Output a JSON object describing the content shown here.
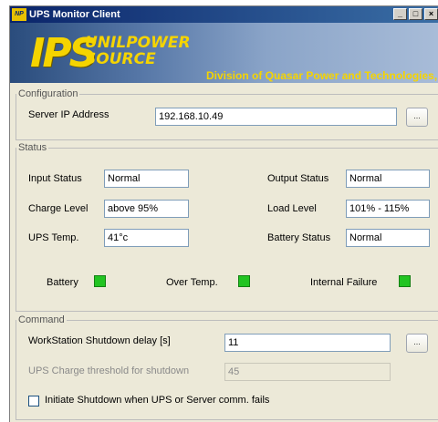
{
  "window": {
    "title": "UPS Monitor Client",
    "app_icon_text": "NP",
    "minimize_glyph": "_",
    "maximize_glyph": "□",
    "close_glyph": "×"
  },
  "banner": {
    "logo_big": "IPS",
    "logo_line1": "UNILPOWER",
    "logo_line2": "SOURCE",
    "division": "Division of Quasar Power and Technologies, Inc."
  },
  "configuration": {
    "legend": "Configuration",
    "server_ip_label": "Server IP Address",
    "server_ip_value": "192.168.10.49",
    "browse_label": "..."
  },
  "status": {
    "legend": "Status",
    "input_status_label": "Input Status",
    "input_status_value": "Normal",
    "output_status_label": "Output Status",
    "output_status_value": "Normal",
    "charge_level_label": "Charge Level",
    "charge_level_value": "above 95%",
    "load_level_label": "Load Level",
    "load_level_value": "101% - 115%",
    "ups_temp_label": "UPS Temp.",
    "ups_temp_value": "41°c",
    "battery_status_label": "Battery Status",
    "battery_status_value": "Normal",
    "battery_label": "Battery",
    "over_temp_label": "Over Temp.",
    "internal_failure_label": "Internal Failure",
    "indicator_color": "#22c422"
  },
  "command": {
    "legend": "Command",
    "ws_shutdown_label": "WorkStation Shutdown delay [s]",
    "ws_shutdown_value": "11",
    "browse_label": "...",
    "charge_threshold_label": "UPS Charge threshold for shutdown",
    "charge_threshold_value": "45",
    "initiate_shutdown_label": "Initiate Shutdown when UPS or Server comm. fails",
    "initiate_shutdown_checked": false
  }
}
